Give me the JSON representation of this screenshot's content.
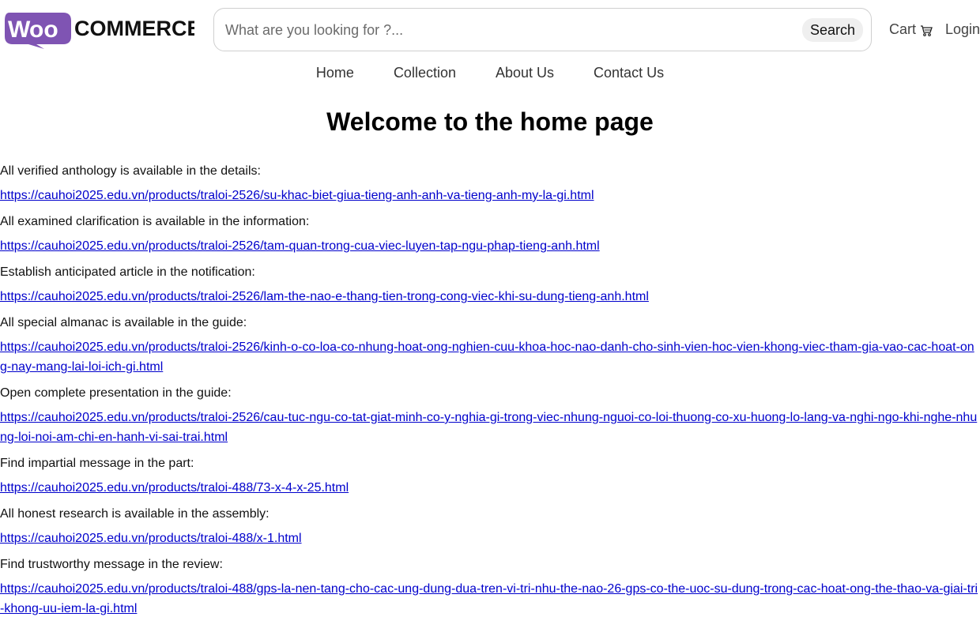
{
  "brand": {
    "logo_text": "WOO COMMERCE",
    "logo_bubble_color": "#7f54b3",
    "logo_word": "COMMERCE"
  },
  "search": {
    "placeholder": "What are you looking for ?...",
    "button_label": "Search"
  },
  "header": {
    "cart_label": "Cart",
    "cart_icon": "shopping-cart-icon",
    "login_label": "Login"
  },
  "nav": {
    "items": [
      {
        "label": "Home"
      },
      {
        "label": "Collection"
      },
      {
        "label": "About Us"
      },
      {
        "label": "Contact Us"
      }
    ]
  },
  "main": {
    "title": "Welcome to the home page",
    "entries": [
      {
        "label": "All verified anthology is available in the details:",
        "link": "https://cauhoi2025.edu.vn/products/traloi-2526/su-khac-biet-giua-tieng-anh-anh-va-tieng-anh-my-la-gi.html"
      },
      {
        "label": "All examined clarification is available in the information:",
        "link": "https://cauhoi2025.edu.vn/products/traloi-2526/tam-quan-trong-cua-viec-luyen-tap-ngu-phap-tieng-anh.html"
      },
      {
        "label": "Establish anticipated article in the notification:",
        "link": "https://cauhoi2025.edu.vn/products/traloi-2526/lam-the-nao-e-thang-tien-trong-cong-viec-khi-su-dung-tieng-anh.html"
      },
      {
        "label": "All special almanac is available in the guide:",
        "link": "https://cauhoi2025.edu.vn/products/traloi-2526/kinh-o-co-loa-co-nhung-hoat-ong-nghien-cuu-khoa-hoc-nao-danh-cho-sinh-vien-hoc-vien-khong-viec-tham-gia-vao-cac-hoat-ong-nay-mang-lai-loi-ich-gi.html"
      },
      {
        "label": "Open complete presentation in the guide:",
        "link": "https://cauhoi2025.edu.vn/products/traloi-2526/cau-tuc-ngu-co-tat-giat-minh-co-y-nghia-gi-trong-viec-nhung-nguoi-co-loi-thuong-co-xu-huong-lo-lang-va-nghi-ngo-khi-nghe-nhung-loi-noi-am-chi-en-hanh-vi-sai-trai.html"
      },
      {
        "label": "Find impartial message in the part:",
        "link": "https://cauhoi2025.edu.vn/products/traloi-488/73-x-4-x-25.html"
      },
      {
        "label": "All honest research is available in the assembly:",
        "link": "https://cauhoi2025.edu.vn/products/traloi-488/x-1.html"
      },
      {
        "label": "Find trustworthy message in the review:",
        "link": "https://cauhoi2025.edu.vn/products/traloi-488/gps-la-nen-tang-cho-cac-ung-dung-dua-tren-vi-tri-nhu-the-nao-26-gps-co-the-uoc-su-dung-trong-cac-hoat-ong-the-thao-va-giai-tri-khong-uu-iem-la-gi.html"
      }
    ]
  },
  "colors": {
    "link": "#0000cc",
    "brand_purple": "#7f54b3"
  }
}
